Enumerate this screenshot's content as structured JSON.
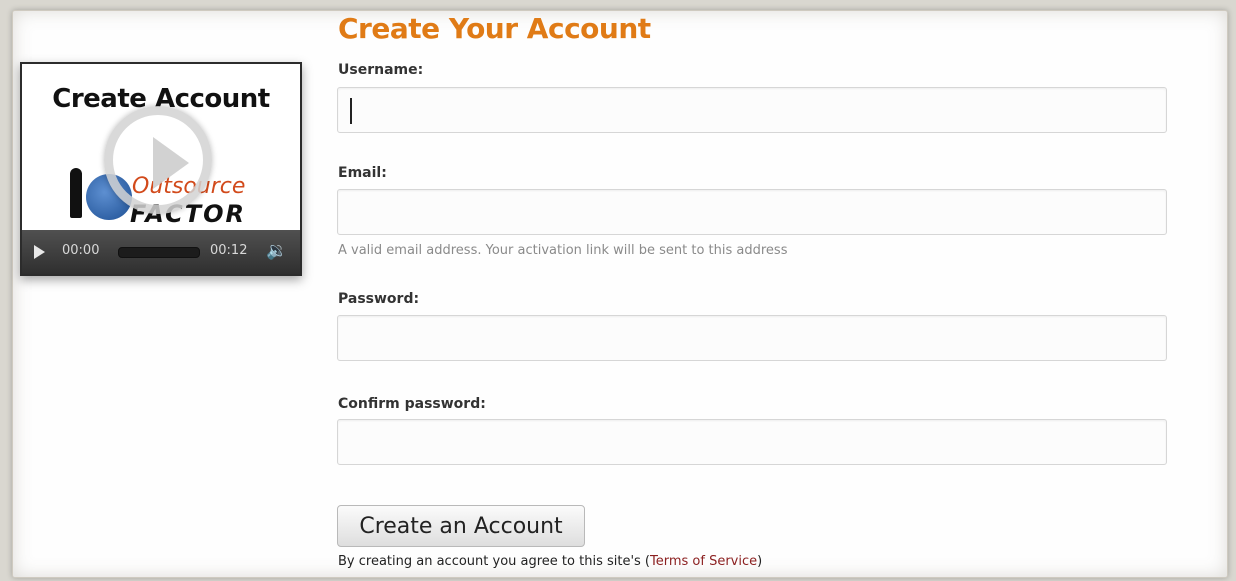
{
  "video": {
    "thumbnail_title": "Create Account",
    "logo_line1": "Outsource",
    "logo_line2": "FACTOR",
    "current_time": "00:00",
    "duration": "00:12",
    "progress": 0,
    "icons": {
      "play": "play-icon",
      "volume": "volume-icon",
      "big_play": "play-circle-icon"
    }
  },
  "form": {
    "title": "Create Your Account",
    "username": {
      "label": "Username:",
      "value": ""
    },
    "email": {
      "label": "Email:",
      "value": "",
      "help": "A valid email address. Your activation link will be sent to this address"
    },
    "password": {
      "label": "Password:",
      "value": ""
    },
    "confirm_password": {
      "label": "Confirm password:",
      "value": ""
    },
    "submit_label": "Create an Account",
    "agreement_prefix": "By creating an account you agree to this site's (",
    "terms_link": "Terms of Service",
    "agreement_suffix": ")"
  },
  "colors": {
    "title_orange": "#e07b16",
    "link_red": "#8b1f1f"
  }
}
